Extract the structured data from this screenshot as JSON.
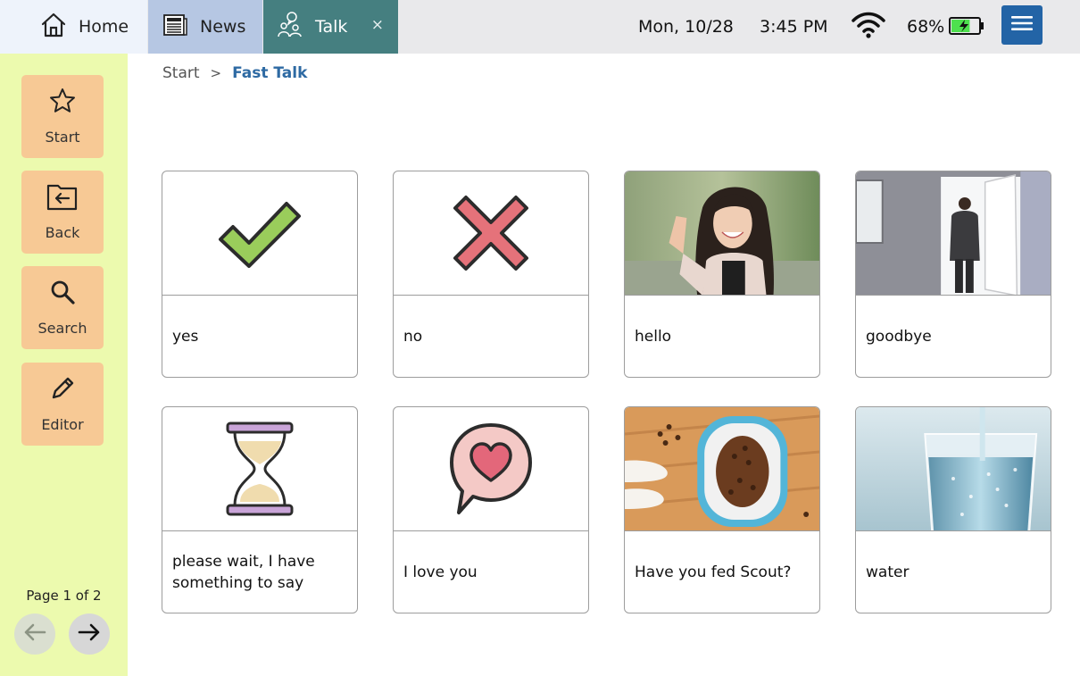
{
  "tabs": {
    "home": {
      "label": "Home",
      "icon": "home-icon"
    },
    "news": {
      "label": "News",
      "icon": "newspaper-icon"
    },
    "talk": {
      "label": "Talk",
      "icon": "people-talking-icon",
      "close": "×"
    }
  },
  "status": {
    "date": "Mon, 10/28",
    "time": "3:45 PM",
    "battery": "68%",
    "battery_level": 0.68
  },
  "sidebar": {
    "buttons": [
      {
        "label": "Start",
        "icon": "star-icon"
      },
      {
        "label": "Back",
        "icon": "back-arrow-icon"
      },
      {
        "label": "Search",
        "icon": "search-icon"
      },
      {
        "label": "Editor",
        "icon": "pencil-icon"
      }
    ],
    "page_indicator": "Page 1 of 2"
  },
  "breadcrumb": {
    "start": "Start",
    "separator": ">",
    "current": "Fast Talk"
  },
  "cards": [
    {
      "label": "yes",
      "image": "checkmark-icon"
    },
    {
      "label": "no",
      "image": "cross-icon"
    },
    {
      "label": "hello",
      "image": "waving-woman-photo"
    },
    {
      "label": "goodbye",
      "image": "man-leaving-door-photo"
    },
    {
      "label": "please wait, I have something to say",
      "image": "hourglass-icon"
    },
    {
      "label": "I love you",
      "image": "heart-speech-bubble-icon"
    },
    {
      "label": "Have you fed Scout?",
      "image": "dog-food-bowl-photo"
    },
    {
      "label": "water",
      "image": "water-glass-photo"
    }
  ],
  "colors": {
    "sidebar_bg": "#ecfaae",
    "side_button": "#f7c995",
    "talk_tab": "#457f80",
    "menu_button": "#2364a6",
    "breadcrumb_current": "#2e6aa3"
  }
}
